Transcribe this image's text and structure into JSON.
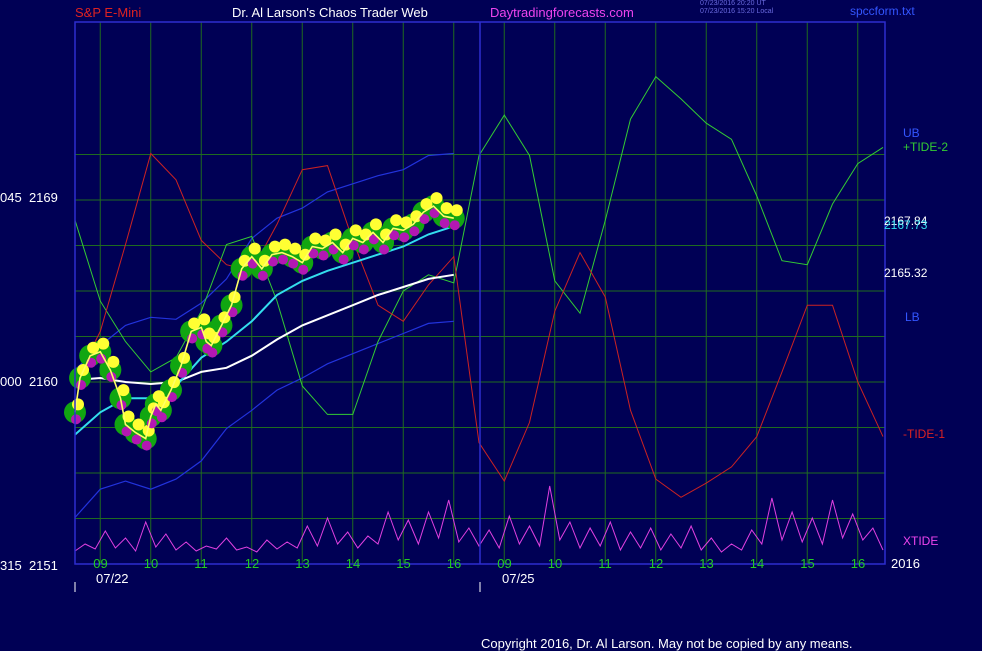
{
  "header": {
    "symbol": "S&P E-Mini",
    "site": "Dr. Al Larson's Chaos Trader Web",
    "url": "Daytradingforecasts.com",
    "stamp_ut": "07/23/2016 20:20 UT",
    "stamp_local": "07/23/2016 15:20 Local",
    "file": "spccform.txt"
  },
  "copyright": "Copyright 2016, Dr. Al Larson. May not be copied by any means.",
  "colors": {
    "background": "#000055",
    "grid": "#1f6b1f",
    "frame": "#2d2dd0",
    "price": "#ffff66",
    "ball_green": "#11a611",
    "ball_yellow": "#ffff33",
    "ball_magenta": "#b318b3",
    "tide_plus": "#33cc33",
    "tide_minus": "#cc2222",
    "xtide": "#e040e0",
    "bands": "#2233dd",
    "ma_white": "#ffffff",
    "ma_cyan": "#33ddee"
  },
  "chart_data": {
    "type": "line",
    "y_ticks": [
      {
        "left": "045",
        "right": "2169"
      },
      {
        "left": "000",
        "right": "2160"
      },
      {
        "left": "315",
        "right": "2151"
      }
    ],
    "x_ticks_day1": [
      "09",
      "10",
      "11",
      "12",
      "13",
      "14",
      "15",
      "16"
    ],
    "x_ticks_day2": [
      "09",
      "10",
      "11",
      "12",
      "13",
      "14",
      "15",
      "16"
    ],
    "date_labels": [
      "07/22",
      "07/25"
    ],
    "year_label": "2016",
    "right_labels": {
      "ub": "UB",
      "tide_plus": "+TIDE-2",
      "level1": "2167.84",
      "level2": "2167.73",
      "level3": "2165.32",
      "lb": "LB",
      "tide_minus": "-TIDE-1",
      "xtide": "XTIDE"
    },
    "ylim": [
      2151,
      2169
    ],
    "hour_range": [
      8.5,
      16.5
    ],
    "price": {
      "name": "S&P E-Mini",
      "points": [
        [
          8.5,
          2158.5
        ],
        [
          8.6,
          2160.2
        ],
        [
          8.8,
          2161.3
        ],
        [
          9.0,
          2161.5
        ],
        [
          9.2,
          2160.6
        ],
        [
          9.4,
          2159.2
        ],
        [
          9.5,
          2157.9
        ],
        [
          9.7,
          2157.5
        ],
        [
          9.9,
          2157.2
        ],
        [
          10.0,
          2158.3
        ],
        [
          10.1,
          2158.9
        ],
        [
          10.2,
          2158.6
        ],
        [
          10.4,
          2159.6
        ],
        [
          10.6,
          2160.8
        ],
        [
          10.8,
          2162.5
        ],
        [
          11.0,
          2162.7
        ],
        [
          11.1,
          2162.0
        ],
        [
          11.2,
          2161.8
        ],
        [
          11.4,
          2162.8
        ],
        [
          11.6,
          2163.8
        ],
        [
          11.8,
          2165.6
        ],
        [
          12.0,
          2166.2
        ],
        [
          12.2,
          2165.6
        ],
        [
          12.4,
          2166.3
        ],
        [
          12.6,
          2166.4
        ],
        [
          12.8,
          2166.2
        ],
        [
          13.0,
          2165.9
        ],
        [
          13.2,
          2166.7
        ],
        [
          13.4,
          2166.6
        ],
        [
          13.6,
          2166.9
        ],
        [
          13.8,
          2166.4
        ],
        [
          14.0,
          2167.1
        ],
        [
          14.2,
          2166.9
        ],
        [
          14.4,
          2167.4
        ],
        [
          14.6,
          2166.9
        ],
        [
          14.8,
          2167.6
        ],
        [
          15.0,
          2167.5
        ],
        [
          15.2,
          2167.8
        ],
        [
          15.4,
          2168.4
        ],
        [
          15.6,
          2168.7
        ],
        [
          15.8,
          2168.2
        ],
        [
          16.0,
          2168.1
        ]
      ]
    },
    "ma_slow": {
      "points": [
        [
          8.5,
          2160.1
        ],
        [
          9.0,
          2160.2
        ],
        [
          9.5,
          2160.0
        ],
        [
          10.0,
          2159.9
        ],
        [
          10.5,
          2160.0
        ],
        [
          11.0,
          2160.5
        ],
        [
          11.5,
          2160.7
        ],
        [
          12.0,
          2161.3
        ],
        [
          12.5,
          2162.1
        ],
        [
          13.0,
          2162.8
        ],
        [
          13.5,
          2163.3
        ],
        [
          14.0,
          2163.8
        ],
        [
          14.5,
          2164.3
        ],
        [
          15.0,
          2164.7
        ],
        [
          15.5,
          2165.1
        ],
        [
          16.0,
          2165.3
        ]
      ]
    },
    "ma_fast": {
      "points": [
        [
          8.5,
          2157.4
        ],
        [
          9.0,
          2158.5
        ],
        [
          9.5,
          2159.2
        ],
        [
          10.0,
          2159.2
        ],
        [
          10.5,
          2159.8
        ],
        [
          11.0,
          2161.2
        ],
        [
          11.5,
          2162.0
        ],
        [
          12.0,
          2163.0
        ],
        [
          12.5,
          2164.3
        ],
        [
          13.0,
          2165.0
        ],
        [
          13.5,
          2165.5
        ],
        [
          14.0,
          2165.9
        ],
        [
          14.5,
          2166.3
        ],
        [
          15.0,
          2166.7
        ],
        [
          15.5,
          2167.3
        ],
        [
          16.0,
          2167.7
        ]
      ]
    },
    "upper_band": {
      "points": [
        [
          8.5,
          2160.6
        ],
        [
          9.0,
          2161.8
        ],
        [
          9.5,
          2162.8
        ],
        [
          10.0,
          2163.2
        ],
        [
          10.5,
          2163.1
        ],
        [
          11.0,
          2163.9
        ],
        [
          11.5,
          2165.1
        ],
        [
          12.0,
          2167.1
        ],
        [
          12.5,
          2168.1
        ],
        [
          13.0,
          2168.6
        ],
        [
          13.5,
          2169.4
        ],
        [
          14.0,
          2169.8
        ],
        [
          14.5,
          2170.2
        ],
        [
          15.0,
          2170.5
        ],
        [
          15.5,
          2171.2
        ],
        [
          16.0,
          2171.3
        ]
      ]
    },
    "lower_band": {
      "points": [
        [
          8.5,
          2153.3
        ],
        [
          9.0,
          2154.7
        ],
        [
          9.5,
          2155.1
        ],
        [
          10.0,
          2154.7
        ],
        [
          10.5,
          2155.2
        ],
        [
          11.0,
          2156.1
        ],
        [
          11.5,
          2157.7
        ],
        [
          12.0,
          2158.6
        ],
        [
          12.5,
          2159.6
        ],
        [
          13.0,
          2160.2
        ],
        [
          13.5,
          2160.9
        ],
        [
          14.0,
          2161.4
        ],
        [
          14.5,
          2161.9
        ],
        [
          15.0,
          2162.4
        ],
        [
          15.5,
          2162.9
        ],
        [
          16.0,
          2163.0
        ]
      ]
    },
    "tide_plus": {
      "name": "+TIDE-2",
      "points": [
        [
          8.5,
          2168.0
        ],
        [
          9.0,
          2164.0
        ],
        [
          9.5,
          2162.0
        ],
        [
          10.0,
          2160.5
        ],
        [
          10.5,
          2161.2
        ],
        [
          11.0,
          2163.5
        ],
        [
          11.5,
          2166.8
        ],
        [
          12.0,
          2167.2
        ],
        [
          12.5,
          2164.0
        ],
        [
          13.0,
          2159.8
        ],
        [
          13.5,
          2158.4
        ],
        [
          14.0,
          2158.4
        ],
        [
          14.5,
          2162.0
        ],
        [
          15.0,
          2164.5
        ],
        [
          15.5,
          2165.3
        ],
        [
          16.0,
          2164.9
        ],
        [
          16.5,
          2171.2
        ],
        [
          17.0,
          2173.2
        ],
        [
          17.5,
          2171.2
        ],
        [
          18.0,
          2165.0
        ],
        [
          18.5,
          2163.4
        ],
        [
          19.0,
          2168.0
        ],
        [
          19.5,
          2173.0
        ],
        [
          20.0,
          2175.1
        ],
        [
          20.5,
          2174.0
        ],
        [
          21.0,
          2172.8
        ],
        [
          21.5,
          2172.0
        ],
        [
          22.0,
          2169.2
        ],
        [
          22.5,
          2166.0
        ],
        [
          23.0,
          2165.8
        ],
        [
          23.5,
          2168.8
        ],
        [
          24.0,
          2170.8
        ],
        [
          24.5,
          2171.6
        ]
      ]
    },
    "tide_minus": {
      "name": "-TIDE-1",
      "points": [
        [
          8.5,
          2160.0
        ],
        [
          9.0,
          2162.5
        ],
        [
          9.5,
          2166.8
        ],
        [
          10.0,
          2171.3
        ],
        [
          10.5,
          2170.0
        ],
        [
          11.0,
          2167.0
        ],
        [
          11.5,
          2165.8
        ],
        [
          12.0,
          2165.5
        ],
        [
          12.5,
          2167.8
        ],
        [
          13.0,
          2170.5
        ],
        [
          13.5,
          2170.7
        ],
        [
          14.0,
          2167.0
        ],
        [
          14.5,
          2163.8
        ],
        [
          15.0,
          2163.0
        ],
        [
          15.5,
          2164.8
        ],
        [
          16.0,
          2166.2
        ],
        [
          16.5,
          2157.0
        ],
        [
          17.0,
          2155.1
        ],
        [
          17.5,
          2158.0
        ],
        [
          18.0,
          2163.5
        ],
        [
          18.5,
          2166.4
        ],
        [
          19.0,
          2164.2
        ],
        [
          19.5,
          2158.6
        ],
        [
          20.0,
          2155.2
        ],
        [
          20.5,
          2154.3
        ],
        [
          21.0,
          2155.0
        ],
        [
          21.5,
          2155.8
        ],
        [
          22.0,
          2157.3
        ],
        [
          22.5,
          2160.5
        ],
        [
          23.0,
          2163.8
        ],
        [
          23.5,
          2163.8
        ],
        [
          24.0,
          2160.0
        ],
        [
          24.5,
          2157.3
        ]
      ]
    },
    "xtide": {
      "name": "XTIDE",
      "points": [
        [
          8.5,
          5
        ],
        [
          8.7,
          12
        ],
        [
          8.9,
          7
        ],
        [
          9.1,
          25
        ],
        [
          9.3,
          8
        ],
        [
          9.5,
          18
        ],
        [
          9.7,
          5
        ],
        [
          9.9,
          34
        ],
        [
          10.1,
          9
        ],
        [
          10.3,
          22
        ],
        [
          10.5,
          6
        ],
        [
          10.7,
          14
        ],
        [
          10.9,
          5
        ],
        [
          11.1,
          10
        ],
        [
          11.3,
          7
        ],
        [
          11.5,
          18
        ],
        [
          11.7,
          6
        ],
        [
          11.9,
          9
        ],
        [
          12.1,
          4
        ],
        [
          12.3,
          16
        ],
        [
          12.5,
          7
        ],
        [
          12.7,
          14
        ],
        [
          12.9,
          8
        ],
        [
          13.1,
          30
        ],
        [
          13.3,
          10
        ],
        [
          13.5,
          38
        ],
        [
          13.7,
          12
        ],
        [
          13.9,
          24
        ],
        [
          14.1,
          8
        ],
        [
          14.3,
          20
        ],
        [
          14.5,
          12
        ],
        [
          14.7,
          44
        ],
        [
          14.9,
          16
        ],
        [
          15.1,
          36
        ],
        [
          15.3,
          12
        ],
        [
          15.5,
          44
        ],
        [
          15.7,
          18
        ],
        [
          15.9,
          56
        ],
        [
          16.1,
          14
        ],
        [
          16.3,
          28
        ],
        [
          16.5,
          10
        ],
        [
          16.7,
          26
        ],
        [
          16.9,
          8
        ],
        [
          17.1,
          40
        ],
        [
          17.3,
          12
        ],
        [
          17.5,
          30
        ],
        [
          17.7,
          10
        ],
        [
          17.9,
          70
        ],
        [
          18.1,
          16
        ],
        [
          18.3,
          34
        ],
        [
          18.5,
          8
        ],
        [
          18.7,
          28
        ],
        [
          18.9,
          10
        ],
        [
          19.1,
          34
        ],
        [
          19.3,
          6
        ],
        [
          19.5,
          24
        ],
        [
          19.7,
          8
        ],
        [
          19.9,
          28
        ],
        [
          20.1,
          6
        ],
        [
          20.3,
          22
        ],
        [
          20.5,
          8
        ],
        [
          20.7,
          30
        ],
        [
          20.9,
          6
        ],
        [
          21.1,
          18
        ],
        [
          21.3,
          4
        ],
        [
          21.5,
          12
        ],
        [
          21.7,
          6
        ],
        [
          21.9,
          26
        ],
        [
          22.1,
          12
        ],
        [
          22.3,
          58
        ],
        [
          22.5,
          16
        ],
        [
          22.7,
          44
        ],
        [
          22.9,
          14
        ],
        [
          23.1,
          38
        ],
        [
          23.3,
          12
        ],
        [
          23.5,
          56
        ],
        [
          23.7,
          18
        ],
        [
          23.9,
          42
        ],
        [
          24.1,
          16
        ],
        [
          24.3,
          28
        ],
        [
          24.5,
          6
        ]
      ]
    }
  }
}
